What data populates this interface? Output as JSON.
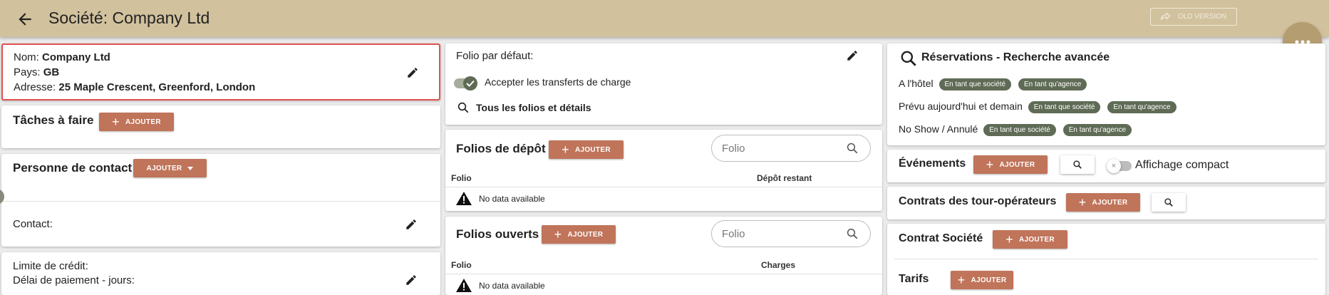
{
  "header": {
    "title": "Société: Company Ltd",
    "old_version_label": "OLD VERSION"
  },
  "company": {
    "name_label": "Nom:",
    "name_value": "Company Ltd",
    "country_label": "Pays:",
    "country_value": "GB",
    "address_label": "Adresse:",
    "address_value": "25 Maple Crescent, Greenford, London"
  },
  "tasks": {
    "title": "Tâches à faire",
    "add_label": "AJOUTER"
  },
  "contact_person": {
    "title": "Personne de contact",
    "add_label": "AJOUTER",
    "contact_label": "Contact:"
  },
  "credit": {
    "limit_label": "Limite de crédit:",
    "payment_delay_label": "Délai de paiement - jours:"
  },
  "folio_settings": {
    "default_folio_label": "Folio par défaut:",
    "accept_transfers_label": "Accepter les transferts de charge",
    "all_folios_label": "Tous les folios et détails"
  },
  "deposit_folios": {
    "title": "Folios de dépôt",
    "add_label": "AJOUTER",
    "search_placeholder": "Folio",
    "columns": [
      "Folio",
      "Dépôt restant"
    ],
    "empty_text": "No data available"
  },
  "open_folios": {
    "title": "Folios ouverts",
    "add_label": "AJOUTER",
    "search_placeholder": "Folio",
    "columns": [
      "Folio",
      "Charges"
    ],
    "empty_text": "No data available"
  },
  "reservations": {
    "title": "Réservations - Recherche avancée",
    "rows": [
      {
        "label": "A l'hôtel",
        "chip1": "En tant que société",
        "chip2": "En tant qu'agence"
      },
      {
        "label": "Prévu aujourd'hui et demain",
        "chip1": "En tant que société",
        "chip2": "En tant qu'agence"
      },
      {
        "label": "No Show / Annulé",
        "chip1": "En tant que société",
        "chip2": "En tant qu'agence"
      }
    ]
  },
  "events": {
    "title": "Événements",
    "add_label": "AJOUTER",
    "compact_label": "Affichage compact"
  },
  "tour_contracts": {
    "title": "Contrats des tour-opérateurs",
    "add_label": "AJOUTER"
  },
  "company_contract": {
    "title": "Contrat Société",
    "add_label": "AJOUTER"
  },
  "rates": {
    "title": "Tarifs",
    "add_label": "AJOUTER"
  },
  "colors": {
    "header_bg": "#d1c19d",
    "accent_button": "#c0745a",
    "chip_bg": "#5f6b55",
    "fab_bg": "#b49d70",
    "highlight_border": "#e05252"
  }
}
